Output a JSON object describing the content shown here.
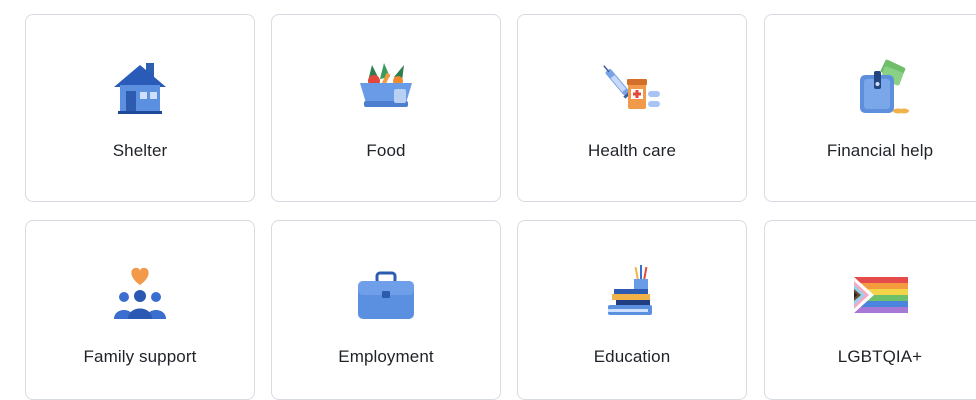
{
  "categories": [
    {
      "label": "Shelter",
      "icon": "house-icon"
    },
    {
      "label": "Food",
      "icon": "food-bowl-icon"
    },
    {
      "label": "Health care",
      "icon": "medicine-icon"
    },
    {
      "label": "Financial help",
      "icon": "wallet-money-icon"
    },
    {
      "label": "Family support",
      "icon": "family-heart-icon"
    },
    {
      "label": "Employment",
      "icon": "briefcase-icon"
    },
    {
      "label": "Education",
      "icon": "books-icon"
    },
    {
      "label": "LGBTQIA+",
      "icon": "pride-flag-icon"
    }
  ]
}
